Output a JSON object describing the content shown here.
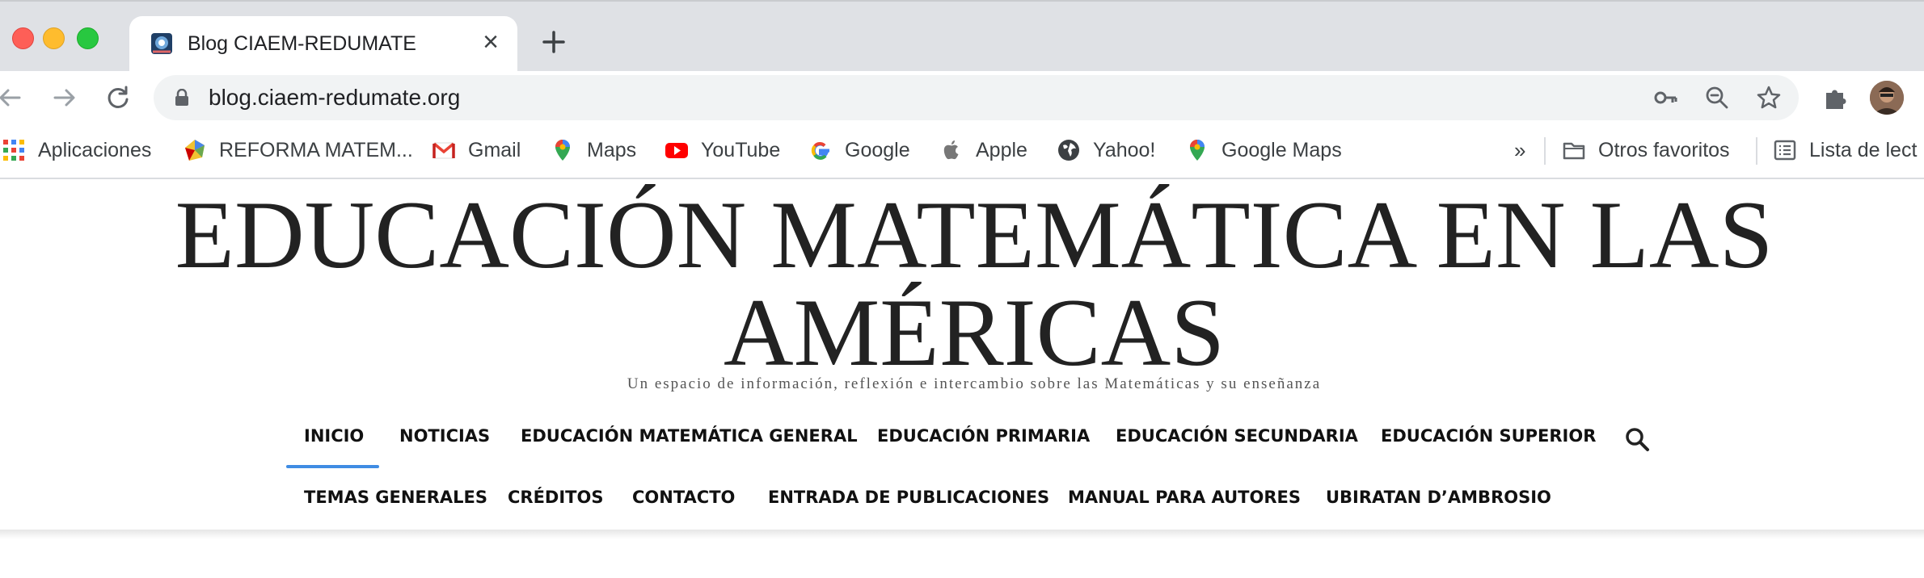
{
  "browser": {
    "tab": {
      "title": "Blog CIAEM-REDUMATE",
      "favicon": "site-logo-icon"
    },
    "address_bar": {
      "url": "blog.ciaem-redumate.org"
    },
    "icons": [
      "back-arrow-icon",
      "forward-arrow-icon",
      "reload-icon",
      "lock-icon",
      "key-icon",
      "zoom-out-icon",
      "star-icon",
      "puzzle-icon",
      "profile-avatar"
    ]
  },
  "bookmarks": {
    "items": [
      {
        "label": "Aplicaciones",
        "icon": "apps-grid-icon"
      },
      {
        "label": "REFORMA MATEM...",
        "icon": "cube-icon"
      },
      {
        "label": "Gmail",
        "icon": "gmail-icon"
      },
      {
        "label": "Maps",
        "icon": "maps-pin-icon"
      },
      {
        "label": "YouTube",
        "icon": "youtube-icon"
      },
      {
        "label": "Google",
        "icon": "google-icon"
      },
      {
        "label": "Apple",
        "icon": "apple-icon"
      },
      {
        "label": "Yahoo!",
        "icon": "globe-icon"
      },
      {
        "label": "Google Maps",
        "icon": "maps-pin-icon"
      }
    ],
    "overflow": "»",
    "other_favorites": "Otros favoritos",
    "reading_list": "Lista de lect"
  },
  "site": {
    "title_line1": "EDUCACIÓN MATEMÁTICA EN LAS",
    "title_line2": "AMÉRICAS",
    "tagline": "Un espacio de información, reflexión e intercambio sobre las Matemáticas y su enseñanza"
  },
  "menu": {
    "row1": [
      "INICIO",
      "NOTICIAS",
      "EDUCACIÓN MATEMÁTICA GENERAL",
      "EDUCACIÓN PRIMARIA",
      "EDUCACIÓN SECUNDARIA",
      "EDUCACIÓN SUPERIOR"
    ],
    "row2": [
      "TEMAS GENERALES",
      "CRÉDITOS",
      "CONTACTO",
      "ENTRADA DE PUBLICACIONES",
      "MANUAL PARA AUTORES",
      "UBIRATAN D’AMBROSIO"
    ],
    "active": "INICIO",
    "accent_color": "#3f8ce3"
  },
  "colors": {
    "tab_strip": "#dfe1e5",
    "omnibox": "#f1f3f4",
    "title_text": "#222222"
  }
}
